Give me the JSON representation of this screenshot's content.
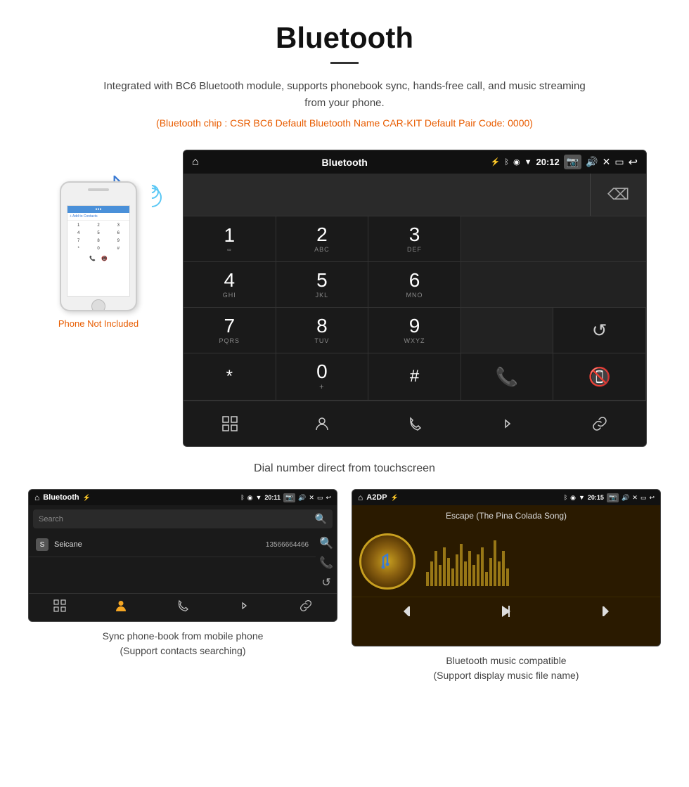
{
  "header": {
    "title": "Bluetooth",
    "description": "Integrated with BC6 Bluetooth module, supports phonebook sync, hands-free call, and music streaming from your phone.",
    "specs": "(Bluetooth chip : CSR BC6    Default Bluetooth Name CAR-KIT    Default Pair Code: 0000)"
  },
  "phone": {
    "not_included": "Phone Not Included",
    "add_contact": "+ Add to Contacts",
    "dial_keys": [
      "1",
      "2",
      "3",
      "4",
      "5",
      "6",
      "7",
      "8",
      "9",
      "*",
      "0",
      "#"
    ]
  },
  "dial_screen": {
    "status_title": "Bluetooth",
    "time": "20:12",
    "keys": [
      {
        "number": "1",
        "letters": "∞"
      },
      {
        "number": "2",
        "letters": "ABC"
      },
      {
        "number": "3",
        "letters": "DEF"
      },
      {
        "number": "4",
        "letters": "GHI"
      },
      {
        "number": "5",
        "letters": "JKL"
      },
      {
        "number": "6",
        "letters": "MNO"
      },
      {
        "number": "7",
        "letters": "PQRS"
      },
      {
        "number": "8",
        "letters": "TUV"
      },
      {
        "number": "9",
        "letters": "WXYZ"
      },
      {
        "number": "*",
        "letters": ""
      },
      {
        "number": "0",
        "letters": "+"
      },
      {
        "number": "#",
        "letters": ""
      }
    ],
    "caption": "Dial number direct from touchscreen"
  },
  "phonebook_screen": {
    "status_title": "Bluetooth",
    "time": "20:11",
    "search_placeholder": "Search",
    "contact_name": "Seicane",
    "contact_number": "13566664466",
    "contact_letter": "S",
    "caption_line1": "Sync phone-book from mobile phone",
    "caption_line2": "(Support contacts searching)"
  },
  "music_screen": {
    "status_title": "A2DP",
    "time": "20:15",
    "song_title": "Escape (The Pina Colada Song)",
    "caption_line1": "Bluetooth music compatible",
    "caption_line2": "(Support display music file name)"
  },
  "nav_icons": {
    "home": "⌂",
    "back": "↩",
    "grid": "⊞",
    "person": "👤",
    "phone": "📞",
    "bluetooth": "Ƀ",
    "link": "🔗",
    "refresh": "↺",
    "camera": "📷",
    "volume": "🔊",
    "close": "✕",
    "minimize": "—",
    "search": "🔍",
    "prev": "⏮",
    "play": "⏯",
    "next": "⏭"
  }
}
